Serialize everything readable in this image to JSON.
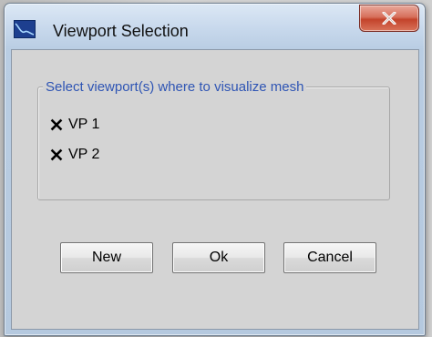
{
  "window": {
    "title": "Viewport Selection",
    "app_icon": "viewport-app-icon",
    "close_icon": "close-x-icon"
  },
  "group": {
    "title": "Select viewport(s) where to visualize mesh",
    "items": [
      {
        "label": "VP 1",
        "checked": true
      },
      {
        "label": "VP 2",
        "checked": true
      }
    ]
  },
  "buttons": {
    "new_label": "New",
    "ok_label": "Ok",
    "cancel_label": "Cancel"
  },
  "colors": {
    "group_title": "#2f55b4",
    "close_button": "#c3432b",
    "client_background": "#d4d4d4"
  }
}
